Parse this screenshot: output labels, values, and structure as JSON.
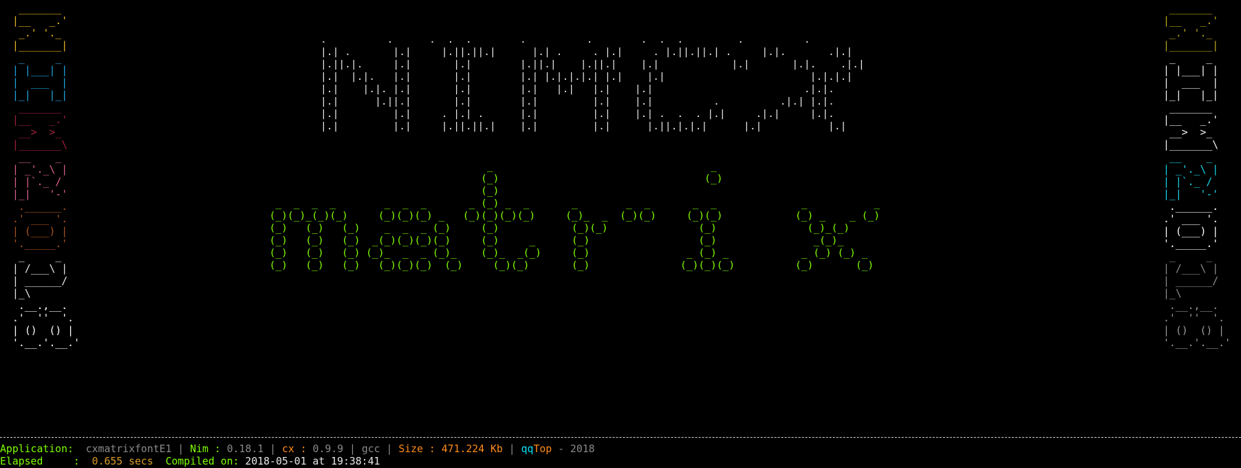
{
  "colors": {
    "background": "#000000",
    "block_n": "#e6b422",
    "block_h": "#1fa7e0",
    "block_z": "#a01e3c",
    "block_r": "#d95f8f",
    "block_o": "#a9531c",
    "block_p": "#e6e6e6",
    "block_oo": "#ffffff",
    "right_block_n": "#b8a415",
    "right_block_h": "#f2f2f2",
    "right_block_z": "#f2f2f2",
    "right_block_r": "#19d3e6",
    "right_block_o": "#ffffff",
    "right_block_p": "#8c8c8c",
    "right_block_oo": "#9a9a9a",
    "title_nimcx": "#e8e8e8",
    "title_matrix": "#7fff00",
    "label_green": "#80ff00",
    "value_grey": "#8a8a8a",
    "accent_orange": "#ff8c1a",
    "accent_cyan": "#00e5ff",
    "accent_amber": "#d89b2b"
  },
  "left_column": [
    {
      "id": "n",
      "art": " _______ \n|__   _.'\n _.' '._ \n|_______|"
    },
    {
      "id": "h",
      "art": " _     _ \n| |___| |\n|  ___  |\n|_|   |_|"
    },
    {
      "id": "z",
      "art": " _______ \n|__   _.'\n __>  >_ \n|_______\\"
    },
    {
      "id": "r",
      "art": " __    _ \n| _'._\\ |\n| |`._ / \n|_|   '-'"
    },
    {
      "id": "o",
      "art": " .______.\n.' ___ '.\n| (___) |\n'._____.'"
    },
    {
      "id": "p",
      "art": " _     _ \n| /___\\ |\n| ______/\n|_\\      "
    },
    {
      "id": "oo",
      "art": " .__.,__.\n.'  ''  '.\n| ()  () |\n'.__.'.__.'"
    }
  ],
  "right_column": [
    {
      "id": "n",
      "art": " _______ \n|__   _.'\n _.' '._ \n|_______|"
    },
    {
      "id": "h",
      "art": " _     _ \n| |___| |\n|  ___  |\n|_|   |_|"
    },
    {
      "id": "z",
      "art": " _______ \n|__   _.'\n __>  >_ \n|_______\\"
    },
    {
      "id": "r",
      "art": " __    _ \n| _'._\\ |\n| |`._ / \n|_|   '-'"
    },
    {
      "id": "o",
      "art": " .______.\n.' ___ '.\n| (___) |\n'._____.'"
    },
    {
      "id": "p",
      "art": " _     _ \n| /___\\ |\n| ______/\n|_\\      "
    },
    {
      "id": "oo",
      "art": " .__.,__.\n.'  ''  '.\n| ()  () |\n'.__.'.__.'"
    }
  ],
  "title_nimcx": {
    "art": ".          .      .  .  .        .          .        .  .  .         .          .\n|.| .       |.|     |.||.||.|      |.| .     . |.|     . |.||.||.| .     |.|.       .|.|\n|.||.|.     |.|       |.|        |.||.|    |.||.|    |.|            |.|       |.|.    .|.|\n|.|  |.|.   |.|       |.|        |.| |.|.|.|.| |.|    |.|                        |.|.|.|\n|.|    |.|. |.|       |.|        |.|   |.|   |.|    |.|                         .|.|.\n|.|      |.||.|       |.|        |.|         |.|    |.|          .          .|.| |.|.\n|.|         |.|     . |.| .      |.|         |.|    |.| .  .  . |.|     .|.|     |.|.\n|.|         |.|     |.||.||.|    |.|         |.|      |.||.|.|.|      |.|           |.|"
  },
  "title_matrix": {
    "art": "                                      _                                    _\n                                     (_)                                  (_)\n                                     (_)\n   _  _  _  _        _  _  _       _ (_) _  _       _        _  _       _  _              _           _\n  (_)(_)_(_)(_)     (_)(_)(_) _   (_)(_)(_)(_)     (_)_  _  (_)(_)     (_)(_)            (_) _    _ (_)\n  (_)   (_)   (_)    _  _  _ (_)     (_)            (_)(_)               (_)               (_)_(_)\n  (_)   (_)   (_)  _(_)(_)(_)(_)     (_)     _      (_)                  (_)                _(_)_\n  (_)   (_)   (_) (_)_  _  _ (_)_    (_)_  _(_)     (_)                _ (_) _            _ (_) (_) _\n  (_)   (_)   (_)   (_)(_)(_)  (_)     (_)(_)       (_)               (_)(_)(_)          (_)       (_)"
  },
  "status": {
    "application_label": "Application:",
    "application_value": "cxmatrixfontE1",
    "sep": "|",
    "nim_label": "Nim",
    "nim_colon": ":",
    "nim_version": "0.18.1",
    "cx_label": "cx",
    "cx_colon": ":",
    "cx_version": "0.9.9",
    "compiler": "gcc",
    "size_label": "Size",
    "size_colon": ":",
    "size_value": "471.224 Kb",
    "brand_qq": "qq",
    "brand_top": "Top",
    "year": "- 2018",
    "elapsed_label": "Elapsed",
    "elapsed_colon": ":",
    "elapsed_value": "0.655 secs",
    "compiled_label": "Compiled on:",
    "compiled_value": "2018-05-01 at 19:38:41"
  }
}
